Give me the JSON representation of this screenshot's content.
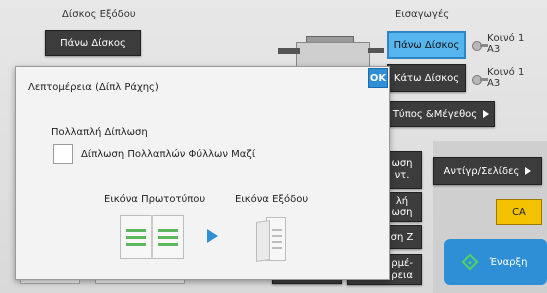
{
  "output_tray": {
    "label": "Δίσκος Εξόδου",
    "button": "Πάνω Δίσκος"
  },
  "input": {
    "label": "Εισαγωγές",
    "trays": [
      {
        "button": "Πάνω Δίσκος",
        "name": "Κοινό 1",
        "size": "A3",
        "selected": true
      },
      {
        "button": "Κάτω Δίσκος",
        "name": "Κοινό 1",
        "size": "A3",
        "selected": false
      }
    ],
    "type_size_button": "Τύπος &Μέγεθος"
  },
  "background_fragments": {
    "btn1_line1": "ωση",
    "btn1_line2": "ντ.",
    "btn2_line1": "λή",
    "btn2_line2": "ωση",
    "btn3": "ση Ζ",
    "btn4_line1": "ρμέ-",
    "btn4_line2": "ρεια"
  },
  "right": {
    "copies_pages_button": "Αντίγρ/Σελίδες",
    "ca_button": "CA",
    "start_button": "Έναρξη"
  },
  "dialog": {
    "title": "Λεπτομέρεια (Δίπλ Ράχης)",
    "ok": "OK",
    "section_label": "Πολλαπλή Δίπλωση",
    "checkbox_label": "Δίπλωση Πολλαπλών Φύλλων Μαζί",
    "checkbox_checked": false,
    "original_image_label": "Εικόνα Πρωτοτύπου",
    "output_image_label": "Εικόνα Εξόδου"
  },
  "colors": {
    "accent_blue": "#2f8fd6",
    "selected_tray": "#56b4ee",
    "ca_yellow": "#f2c200",
    "start_green": "#4fd25f",
    "doc_lines_green": "#5cb85c"
  }
}
